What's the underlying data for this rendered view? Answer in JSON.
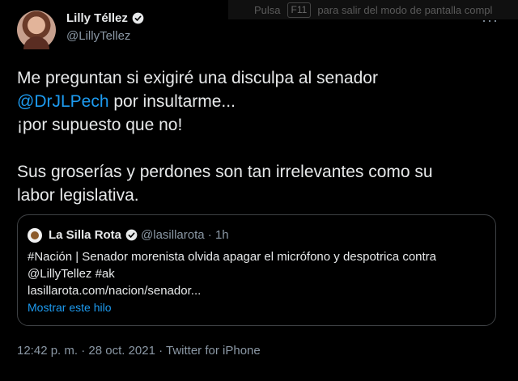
{
  "fullscreen_hint": {
    "prefix": "Pulsa",
    "key": "F11",
    "suffix": "para salir del modo de pantalla compl"
  },
  "author": {
    "display_name": "Lilly Téllez",
    "handle": "@LillyTellez",
    "verified": true
  },
  "more_icon": "more-options-icon",
  "tweet": {
    "line1": "Me preguntan si exigiré una disculpa al  senador",
    "line2_mention": "@DrJLPech",
    "line2_rest": " por insultarme...",
    "line3": "¡por supuesto que no!",
    "line4": "Sus groserías y perdones son tan irrelevantes como su",
    "line5": "labor legislativa."
  },
  "quoted": {
    "display_name": "La Silla Rota",
    "handle_time": "@lasillarota · 1h",
    "body_line1": "#Nación | Senador morenista olvida apagar el micrófono y despotrica contra",
    "body_line2": "@LillyTellez #ak",
    "body_line3": "lasillarota.com/nacion/senador...",
    "show_thread": "Mostrar este hilo"
  },
  "meta": {
    "timestamp": "12:42 p. m. · 28 oct. 2021 · Twitter for iPhone"
  },
  "colors": {
    "background": "#000000",
    "text": "#e7e9ea",
    "secondary": "#8b98a5",
    "link": "#1d9bf0",
    "border": "#3e4144"
  }
}
